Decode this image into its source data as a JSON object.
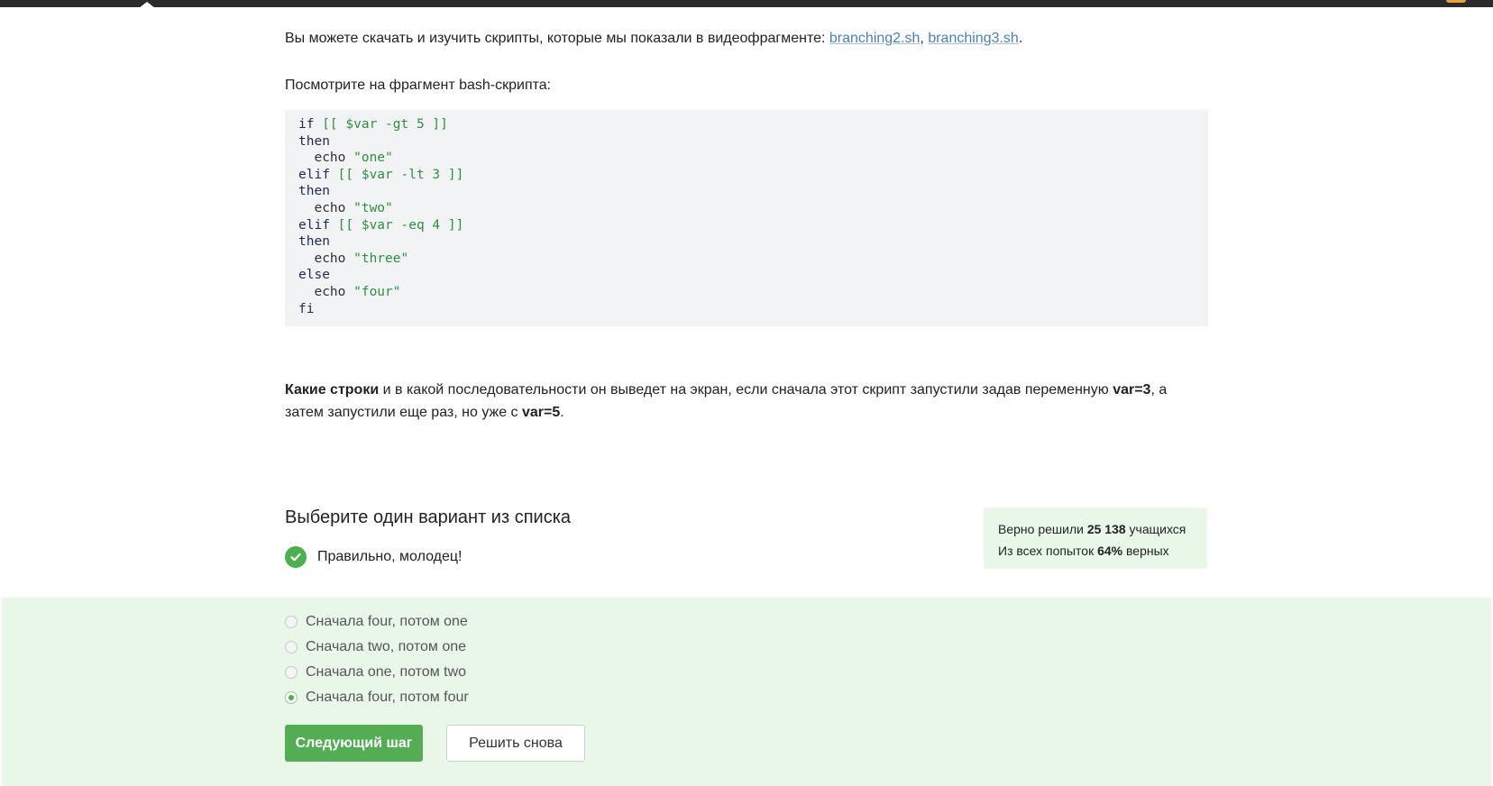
{
  "intro": {
    "text": "Вы можете скачать и изучить скрипты, которые мы показали в видеофрагменте: ",
    "link1": "branching2.sh",
    "sep": ", ",
    "link2": "branching3.sh",
    "end": "."
  },
  "lookat": "Посмотрите на фрагмент bash-скрипта:",
  "code": {
    "lines": [
      [
        {
          "c": "kw",
          "t": "if "
        },
        {
          "c": "gr",
          "t": "[[ $var -gt 5 ]]"
        }
      ],
      [
        {
          "c": "kw",
          "t": "then"
        }
      ],
      [
        {
          "c": "tx",
          "t": "  echo "
        },
        {
          "c": "gr",
          "t": "\"one\""
        }
      ],
      [
        {
          "c": "kw",
          "t": "elif "
        },
        {
          "c": "gr",
          "t": "[[ $var -lt 3 ]]"
        }
      ],
      [
        {
          "c": "kw",
          "t": "then"
        }
      ],
      [
        {
          "c": "tx",
          "t": "  echo "
        },
        {
          "c": "gr",
          "t": "\"two\""
        }
      ],
      [
        {
          "c": "kw",
          "t": "elif "
        },
        {
          "c": "gr",
          "t": "[[ $var -eq 4 ]]"
        }
      ],
      [
        {
          "c": "kw",
          "t": "then"
        }
      ],
      [
        {
          "c": "tx",
          "t": "  echo "
        },
        {
          "c": "gr",
          "t": "\"three\""
        }
      ],
      [
        {
          "c": "kw",
          "t": "else"
        }
      ],
      [
        {
          "c": "tx",
          "t": "  echo "
        },
        {
          "c": "gr",
          "t": "\"four\""
        }
      ],
      [
        {
          "c": "kw",
          "t": "fi"
        }
      ]
    ]
  },
  "question": {
    "bold1": "Какие строки",
    "part1": " и в какой последовательности он выведет на экран, если сначала этот скрипт запустили задав переменную ",
    "bold2": "var=3",
    "part2": ", а затем запустили еще раз, но уже с ",
    "bold3": "var=5",
    "part3": "."
  },
  "choose_title": "Выберите один вариант из списка",
  "result_text": "Правильно, молодец!",
  "stats": {
    "line1_prefix": "Верно решили ",
    "line1_value": "25 138",
    "line1_suffix": " учащихся",
    "line2_prefix": "Из всех попыток ",
    "line2_value": "64%",
    "line2_suffix": " верных"
  },
  "options": [
    {
      "label": "Сначала four, потом one",
      "selected": false
    },
    {
      "label": "Сначала two, потом one",
      "selected": false
    },
    {
      "label": "Сначала one, потом two",
      "selected": false
    },
    {
      "label": "Сначала four, потом four",
      "selected": true
    }
  ],
  "buttons": {
    "next": "Следующий шаг",
    "again": "Решить снова"
  },
  "colors": {
    "accent": "#54ad54",
    "answer_bg": "#e9f7e9",
    "link": "#4a7fbf"
  }
}
